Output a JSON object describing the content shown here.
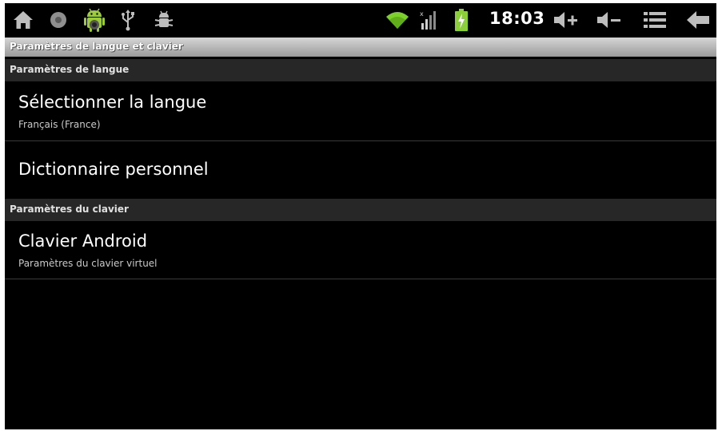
{
  "status_bar": {
    "left_icons": [
      "home-icon",
      "record-icon",
      "android-icon",
      "usb-icon",
      "debug-bug-icon"
    ],
    "right_icons": [
      "wifi-icon",
      "signal-icon",
      "battery-charging-icon"
    ],
    "time": "18:03",
    "buttons": [
      "volume-up-icon",
      "volume-down-icon",
      "menu-icon",
      "back-icon"
    ]
  },
  "title_bar": {
    "title": "Paramètres de langue et clavier"
  },
  "sections": [
    {
      "header": "Paramètres de langue",
      "items": [
        {
          "title": "Sélectionner la langue",
          "summary": "Français (France)"
        },
        {
          "title": "Dictionnaire personnel",
          "summary": ""
        }
      ]
    },
    {
      "header": "Paramètres du clavier",
      "items": [
        {
          "title": "Clavier Android",
          "summary": "Paramètres du clavier virtuel"
        }
      ]
    }
  ],
  "colors": {
    "background": "#000000",
    "section_header_bg": "#272727",
    "title_bar_bg": "#b0b0b0",
    "wifi_green": "#7bd12a",
    "battery_green": "#8bd03a"
  }
}
